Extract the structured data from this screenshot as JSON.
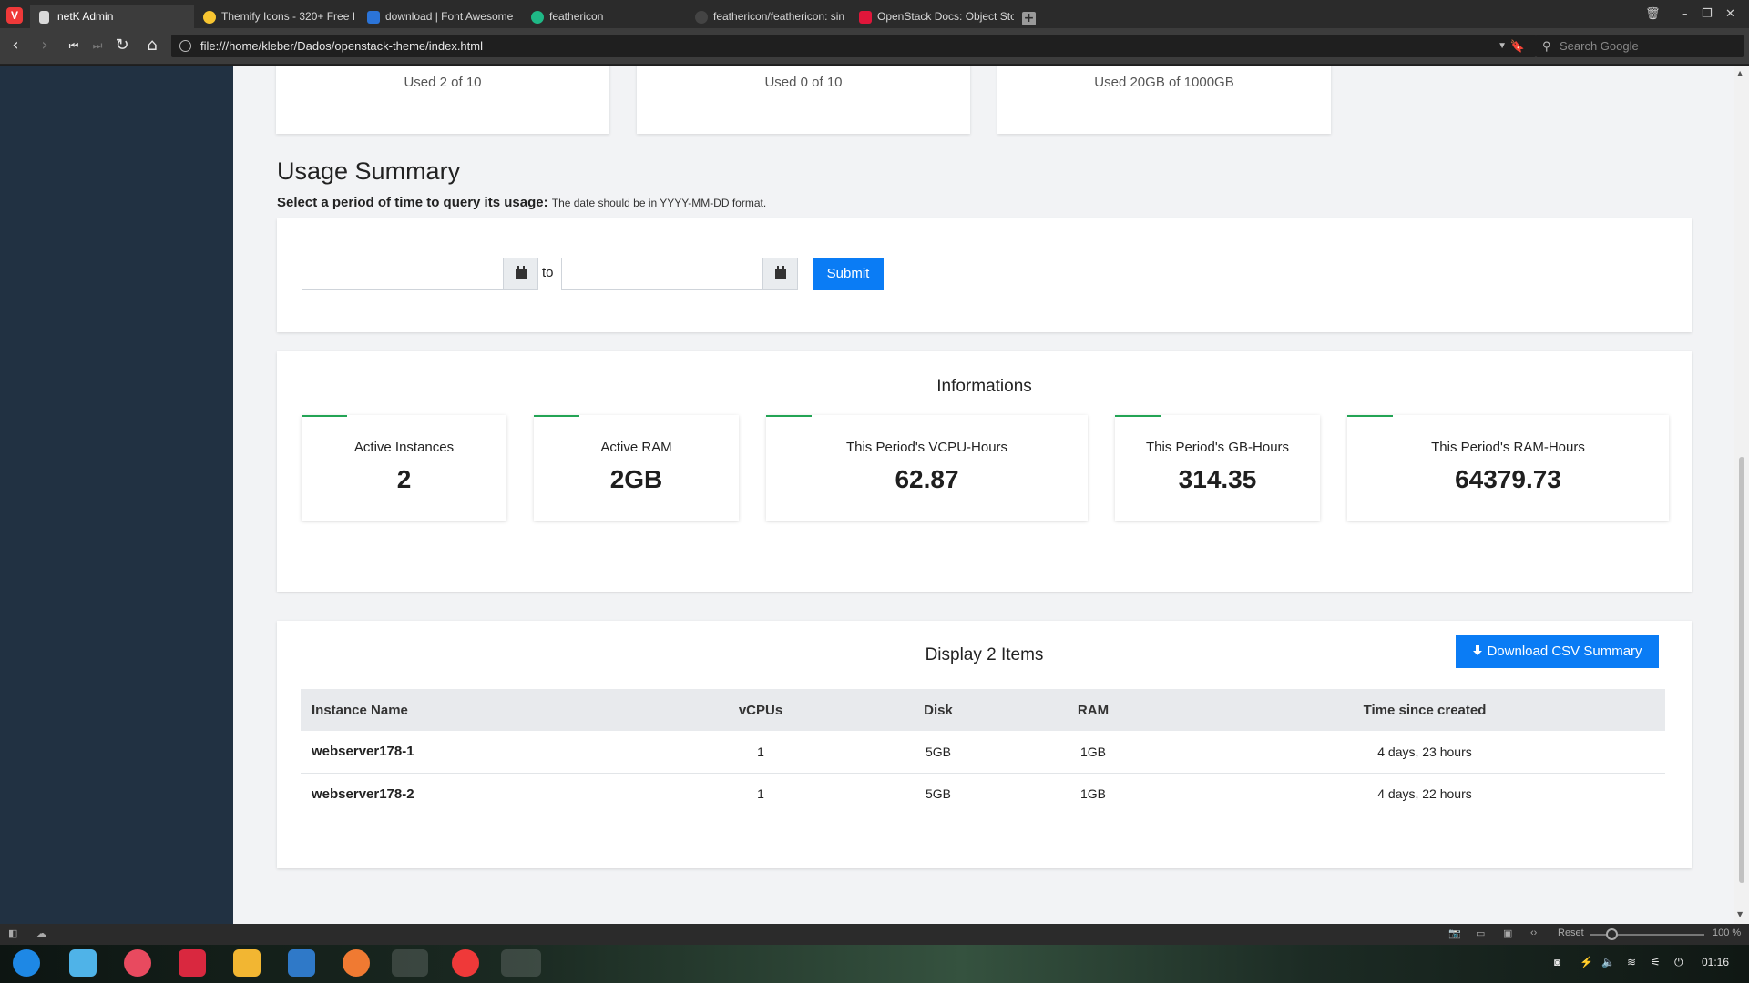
{
  "browser": {
    "tabs": [
      {
        "label": "netK Admin",
        "active": true
      },
      {
        "label": "Themify Icons - 320+ Free I",
        "active": false
      },
      {
        "label": "download | Font Awesome",
        "active": false
      },
      {
        "label": "feathericon",
        "active": false
      },
      {
        "label": "feathericon/feathericon: sin",
        "active": false
      },
      {
        "label": "OpenStack Docs: Object Sto",
        "active": false
      }
    ],
    "url": "file:///home/kleber/Dados/openstack-theme/index.html",
    "search_placeholder": "Search Google"
  },
  "quotas": [
    {
      "text": "Used 2 of 10"
    },
    {
      "text": "Used 0 of 10"
    },
    {
      "text": "Used 20GB of 1000GB"
    }
  ],
  "usage": {
    "title": "Usage Summary",
    "subtitle": "Select a period of time to query its usage:",
    "hint": "The date should be in YYYY-MM-DD format.",
    "to_label": "to",
    "submit_label": "Submit"
  },
  "informations": {
    "title": "Informations",
    "stats": [
      {
        "label": "Active Instances",
        "value": "2"
      },
      {
        "label": "Active RAM",
        "value": "2GB"
      },
      {
        "label": "This Period's VCPU-Hours",
        "value": "62.87"
      },
      {
        "label": "This Period's GB-Hours",
        "value": "314.35"
      },
      {
        "label": "This Period's RAM-Hours",
        "value": "64379.73"
      }
    ]
  },
  "instances": {
    "title": "Display 2 Items",
    "csv_label": "Download CSV Summary",
    "columns": [
      "Instance Name",
      "vCPUs",
      "Disk",
      "RAM",
      "Time since created"
    ],
    "rows": [
      [
        "webserver178-1",
        "1",
        "5GB",
        "1GB",
        "4 days, 23 hours"
      ],
      [
        "webserver178-2",
        "1",
        "5GB",
        "1GB",
        "4 days, 22 hours"
      ]
    ]
  },
  "statusbar": {
    "reset_label": "Reset",
    "zoom": "100 %"
  },
  "taskbar": {
    "clock": "01:16"
  },
  "colors": {
    "primary": "#0a7cf5",
    "accent_green": "#23a455",
    "sidebar": "#213142"
  }
}
